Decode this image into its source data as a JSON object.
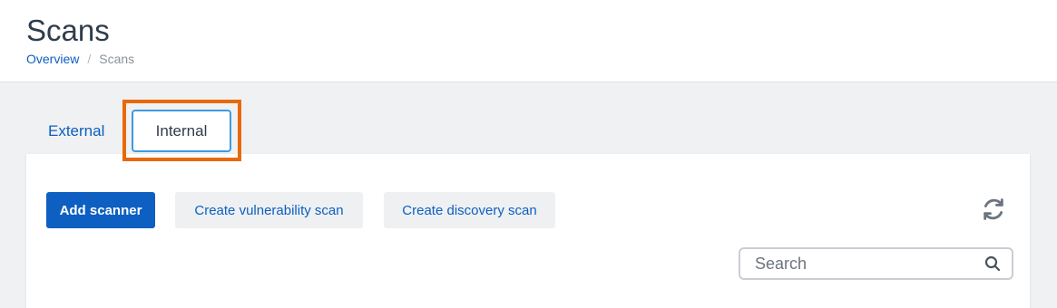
{
  "header": {
    "title": "Scans",
    "breadcrumb": [
      {
        "label": "Overview"
      },
      {
        "label": "Scans"
      }
    ],
    "separator": "/"
  },
  "tabs": [
    {
      "label": "External",
      "active": false
    },
    {
      "label": "Internal",
      "active": true
    }
  ],
  "toolbar": {
    "add_scanner": "Add scanner",
    "create_vulnerability_scan": "Create vulnerability scan",
    "create_discovery_scan": "Create discovery scan",
    "refresh_icon": "refresh-icon"
  },
  "search": {
    "value": "",
    "placeholder": "Search"
  },
  "colors": {
    "accent": "#0d5fc1",
    "highlight": "#e8690a",
    "active_tab_border": "#3d9be0"
  }
}
